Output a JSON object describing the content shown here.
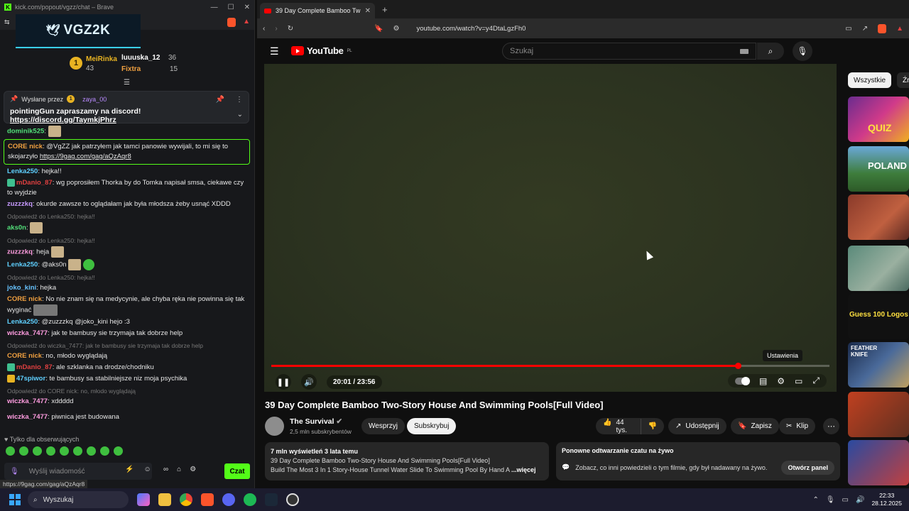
{
  "chat_window": {
    "title": "kick.com/popout/vgzz/chat – Brave",
    "banner": "VGZ2K",
    "leaderboard": {
      "rank": "1",
      "first_name": "MeiRinka",
      "first_count": "43",
      "second_name": "luuuska_12",
      "second_count": "36",
      "third_name": "Fixtra",
      "third_count": "15"
    },
    "pinned": {
      "sent_by_label": "Wysłane przez",
      "sender": "zaya_00",
      "text": "pointingGun zapraszamy na discord! ",
      "link": "https://discord.gg/TaymkjPhrz"
    },
    "messages": [
      {
        "user": "dominik525",
        "text": ""
      },
      {
        "user": "CORE nick",
        "text": "@VgZZ jak patrzyłem jak tamci panowie wywijali, to mi się to skojarzyło ",
        "link": "https://9gag.com/gag/aQzAqr8"
      },
      {
        "user": "Lenka250",
        "text": "hejka!!"
      },
      {
        "user": "mDanio_87",
        "text": "wg poprosiłem Thorka by do Tomka napisał smsa, ciekawe czy to wyjdzie"
      },
      {
        "user": "zuzzzkq",
        "text": "okurde zawsze to oglądałam jak była młodsza żeby usnąć XDDD"
      },
      {
        "reply": "Odpowiedź do Lenka250: hejka!!"
      },
      {
        "user": "aks0n",
        "text": ""
      },
      {
        "reply": "Odpowiedź do Lenka250: hejka!!"
      },
      {
        "user": "zuzzzkq",
        "text": "heja"
      },
      {
        "user": "Lenka250",
        "text": "@aks0n"
      },
      {
        "reply": "Odpowiedź do Lenka250: hejka!!"
      },
      {
        "user": "joko_kini",
        "text": "hejka"
      },
      {
        "user": "CORE nick",
        "text": "No nie znam się na medycynie, ale chyba ręka nie powinna się tak wyginać"
      },
      {
        "user": "Lenka250",
        "text": "@zuzzzkq @joko_kini hejo :3"
      },
      {
        "user": "wiczka_7477",
        "text": "jak te bambusy sie trzymaja tak dobrze help"
      },
      {
        "reply": "Odpowiedź do wiczka_7477: jak te bambusy sie trzymaja tak dobrze help"
      },
      {
        "user": "CORE nick",
        "text": "no, młodo wyglądają"
      },
      {
        "user": "mDanio_87",
        "text": "ale szklanka na drodze/chodniku"
      },
      {
        "user": "47spiwor",
        "text": "te bambusy sa stabilniejsze niz moja psychika"
      },
      {
        "reply": "Odpowiedź do CORE nick: no, młodo wyglądają"
      },
      {
        "user": "wiczka_7477",
        "text": "xddddd"
      },
      {
        "user": "wiczka_7477",
        "text": "piwnica jest budowana"
      }
    ],
    "followers_only": "Tylko dla obserwujących",
    "input_placeholder": "Wyślij wiadomość",
    "send_label": "Czat",
    "status_url": "https://9gag.com/gag/aQzAqr8"
  },
  "browser": {
    "tab_title": "39 Day Complete Bamboo Tw",
    "url": "youtube.com/watch?v=y4DtaLgzFh0"
  },
  "youtube": {
    "logo": "YouTube",
    "logo_region": "PL",
    "search_placeholder": "Szukaj",
    "settings_tooltip": "Ustawienia",
    "time": "20:01 / 23:56",
    "progress_fraction": 0.836,
    "title": "39 Day Complete Bamboo Two-Story House And Swimming Pools[Full Video]",
    "channel": "The Survival",
    "subs": "2,5 mln subskrybentów",
    "support_label": "Wesprzyj",
    "subscribe_label": "Subskrybuj",
    "likes": "44 tys.",
    "share_label": "Udostępnij",
    "save_label": "Zapisz",
    "clip_label": "Klip",
    "desc_meta": "7 mln wyświetleń  3 lata temu",
    "desc_line2": "39 Day Complete Bamboo Two-Story House And Swimming Pools[Full Video]",
    "desc_line3": "Build The Most 3 In 1 Story-House Tunnel Water Slide To Swimming Pool By Hand A ",
    "desc_more": "...więcej",
    "replay_title": "Ponowne odtwarzanie czatu na żywo",
    "replay_text": "Zobacz, co inni powiedzieli o tym filmie, gdy był nadawany na żywo.",
    "replay_button": "Otwórz panel",
    "chips": [
      "Wszystkie",
      "Źró"
    ],
    "thumb_texts": [
      "QUIZ",
      "POLAND",
      "",
      "",
      "Guess 100 Logos",
      "FEATHER KNIFE",
      "",
      ""
    ]
  },
  "taskbar": {
    "search_label": "Wyszukaj",
    "time": "22:33",
    "date": "28.12.2025"
  }
}
